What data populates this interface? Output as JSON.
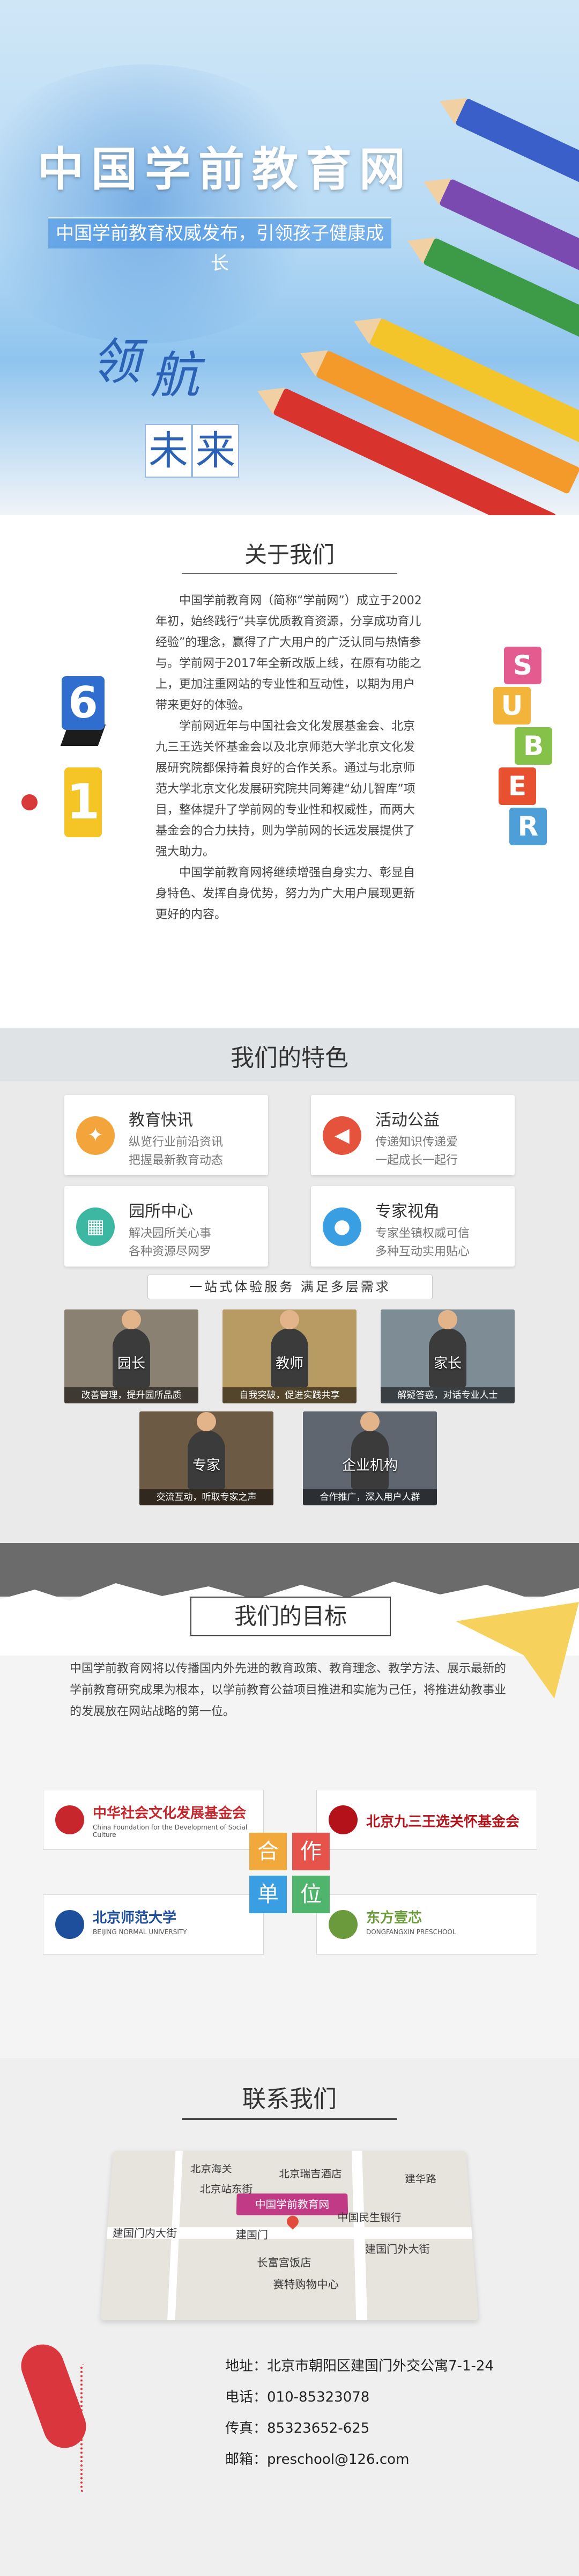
{
  "hero": {
    "title": "中国学前教育网",
    "subtitle": "中国学前教育权威发布，引领孩子健康成长",
    "lead_char_1": "领",
    "lead_char_2": "航",
    "future_chars": [
      "未",
      "来"
    ]
  },
  "about": {
    "title": "关于我们",
    "paragraphs": [
      "中国学前教育网（简称“学前网”）成立于2002年初，始终践行“共享优质教育资源，分享成功育儿经验”的理念，赢得了广大用户的广泛认同与热情参与。学前网于2017年全新改版上线，在原有功能之上，更加注重网站的专业性和互动性，以期为用户带来更好的体验。",
      "学前网近年与中国社会文化发展基金会、北京九三王选关怀基金会以及北京师范大学北京文化发展研究院都保持着良好的合作关系。通过与北京师范大学北京文化发展研究院共同筹建“幼儿智库”项目，整体提升了学前网的专业性和权威性，而两大基金会的合力扶持，则为学前网的长远发展提供了强大助力。",
      "中国学前教育网将继续增强自身实力、彰显自身特色、发挥自身优势，努力为广大用户展现更新更好的内容。"
    ],
    "blocks": [
      "S",
      "U",
      "B",
      "E",
      "R"
    ]
  },
  "features": {
    "title": "我们的特色",
    "cards": [
      {
        "title": "教育快讯",
        "line1": "纵览行业前沿资讯",
        "line2": "把握最新教育动态",
        "icon": "lightbulb-icon",
        "color": "#f3a43a"
      },
      {
        "title": "活动公益",
        "line1": "传递知识传递爱",
        "line2": "一起成长一起行",
        "icon": "megaphone-icon",
        "color": "#e5533d"
      },
      {
        "title": "园所中心",
        "line1": "解决园所关心事",
        "line2": "各种资源尽网罗",
        "icon": "building-icon",
        "color": "#3cb7a2"
      },
      {
        "title": "专家视角",
        "line1": "专家坐镇权威可信",
        "line2": "多种互动实用贴心",
        "icon": "people-icon",
        "color": "#3a9ee3"
      }
    ],
    "slogan": "一站式体验服务  满足多层需求",
    "photos": [
      {
        "role": "园长",
        "caption": "改善管理，提升园所品质",
        "bg": "#8a8172"
      },
      {
        "role": "教师",
        "caption": "自我突破，促进实践共享",
        "bg": "#b89a63"
      },
      {
        "role": "家长",
        "caption": "解疑答惑，对话专业人士",
        "bg": "#7e8c95"
      },
      {
        "role": "专家",
        "caption": "交流互动，听取专家之声",
        "bg": "#6d5a45"
      },
      {
        "role": "企业机构",
        "caption": "合作推广，深入用户人群",
        "bg": "#5f6670"
      }
    ]
  },
  "goals": {
    "title": "我们的目标",
    "body": "中国学前教育网将以传播国内外先进的教育政策、教育理念、教学方法、展示最新的学前教育研究成果为根本，以学前教育公益项目推进和实施为己任，将推进幼教事业的发展放在网站战略的第一位。",
    "coop_chars": [
      "合",
      "作",
      "单",
      "位"
    ],
    "partners": [
      {
        "name": "中华社会文化发展基金会",
        "sub": "China Foundation for the Development of Social Culture",
        "color": "#c7262c"
      },
      {
        "name": "北京九三王选关怀基金会",
        "sub": "",
        "color": "#b3121a"
      },
      {
        "name": "北京师范大学",
        "sub": "BEIJING NORMAL UNIVERSITY",
        "color": "#1d4f9c"
      },
      {
        "name": "东方壹芯",
        "sub": "DONGFANGXIN PRESCHOOL",
        "color": "#6a9a3b"
      }
    ]
  },
  "contact": {
    "title": "联系我们",
    "map_badge": "中国学前教育网",
    "map_labels": [
      "北京海关",
      "北京站东街",
      "北京瑞吉酒店",
      "中国民生银行",
      "建国门内大街",
      "建国门外大街",
      "建国门",
      "长富宫饭店",
      "赛特购物中心",
      "建华路"
    ],
    "address": "地址：北京市朝阳区建国门外交公寓7-1-24",
    "phone": "电话：010-85323078",
    "fax": "传真：85323652-625",
    "email": "邮箱：preschool@126.com"
  }
}
